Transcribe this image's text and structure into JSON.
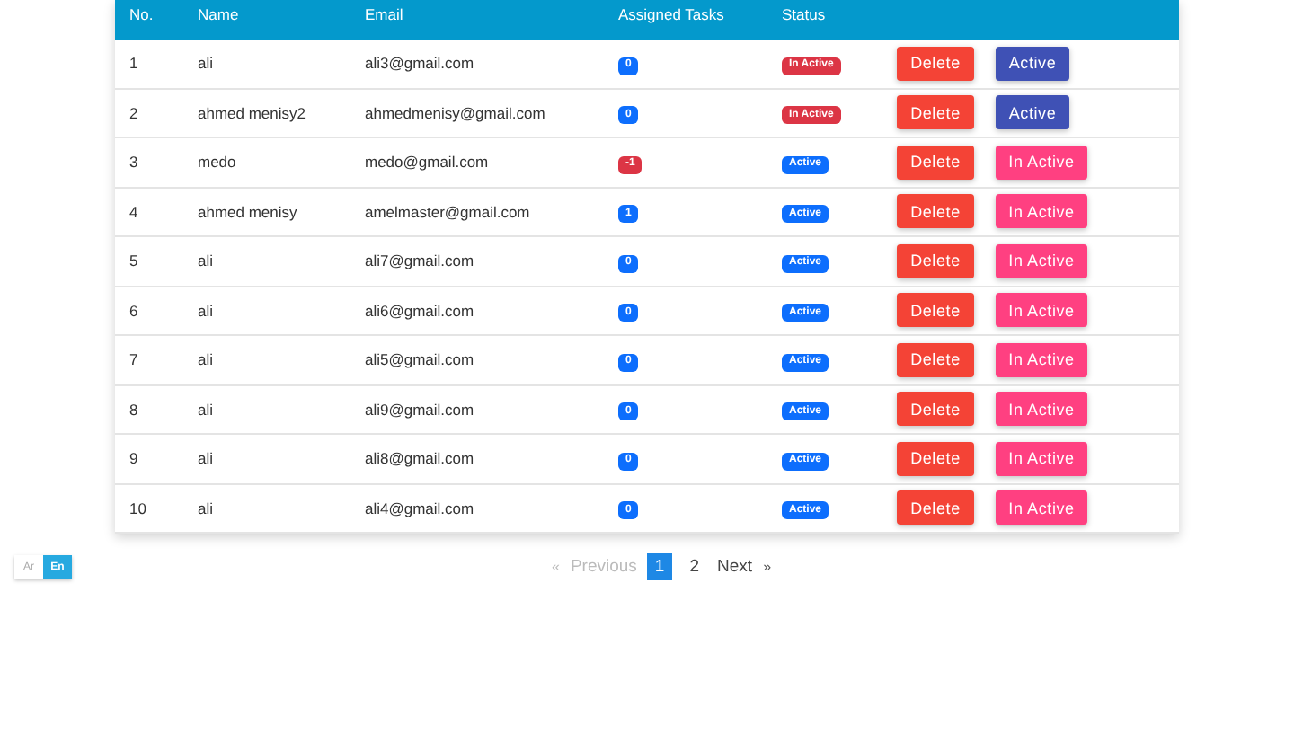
{
  "table": {
    "columns": [
      "No.",
      "Name",
      "Email",
      "Assigned Tasks",
      "Status"
    ],
    "rows": [
      {
        "no": "1",
        "name": "ali",
        "email": "ali3@gmail.com",
        "tasks": {
          "text": "0",
          "color": "#0d6efd"
        },
        "status": {
          "label": "In Active",
          "active": false
        },
        "delete": "Delete",
        "toggle": "Active"
      },
      {
        "no": "2",
        "name": "ahmed menisy2",
        "email": "ahmedmenisy@gmail.com",
        "tasks": {
          "text": "0",
          "color": "#0d6efd"
        },
        "status": {
          "label": "In Active",
          "active": false
        },
        "delete": "Delete",
        "toggle": "Active"
      },
      {
        "no": "3",
        "name": "medo",
        "email": "medo@gmail.com",
        "tasks": {
          "text": "-1",
          "color": "#dc3545"
        },
        "status": {
          "label": "Active",
          "active": true
        },
        "delete": "Delete",
        "toggle": "In Active"
      },
      {
        "no": "4",
        "name": "ahmed menisy",
        "email": "amelmaster@gmail.com",
        "tasks": {
          "text": "1",
          "color": "#0d6efd"
        },
        "status": {
          "label": "Active",
          "active": true
        },
        "delete": "Delete",
        "toggle": "In Active"
      },
      {
        "no": "5",
        "name": "ali",
        "email": "ali7@gmail.com",
        "tasks": {
          "text": "0",
          "color": "#0d6efd"
        },
        "status": {
          "label": "Active",
          "active": true
        },
        "delete": "Delete",
        "toggle": "In Active"
      },
      {
        "no": "6",
        "name": "ali",
        "email": "ali6@gmail.com",
        "tasks": {
          "text": "0",
          "color": "#0d6efd"
        },
        "status": {
          "label": "Active",
          "active": true
        },
        "delete": "Delete",
        "toggle": "In Active"
      },
      {
        "no": "7",
        "name": "ali",
        "email": "ali5@gmail.com",
        "tasks": {
          "text": "0",
          "color": "#0d6efd"
        },
        "status": {
          "label": "Active",
          "active": true
        },
        "delete": "Delete",
        "toggle": "In Active"
      },
      {
        "no": "8",
        "name": "ali",
        "email": "ali9@gmail.com",
        "tasks": {
          "text": "0",
          "color": "#0d6efd"
        },
        "status": {
          "label": "Active",
          "active": true
        },
        "delete": "Delete",
        "toggle": "In Active"
      },
      {
        "no": "9",
        "name": "ali",
        "email": "ali8@gmail.com",
        "tasks": {
          "text": "0",
          "color": "#0d6efd"
        },
        "status": {
          "label": "Active",
          "active": true
        },
        "delete": "Delete",
        "toggle": "In Active"
      },
      {
        "no": "10",
        "name": "ali",
        "email": "ali4@gmail.com",
        "tasks": {
          "text": "0",
          "color": "#0d6efd"
        },
        "status": {
          "label": "Active",
          "active": true
        },
        "delete": "Delete",
        "toggle": "In Active"
      }
    ]
  },
  "language": [
    {
      "label": "Ar",
      "selected": false
    },
    {
      "label": "En",
      "selected": true
    }
  ],
  "pagination": {
    "previous": {
      "arrow": "«",
      "label": "Previous",
      "disabled": true
    },
    "pages": [
      {
        "label": "1",
        "selected": true
      },
      {
        "label": "2",
        "selected": false
      }
    ],
    "next": {
      "label": "Next",
      "arrow": "»",
      "disabled": false
    }
  }
}
